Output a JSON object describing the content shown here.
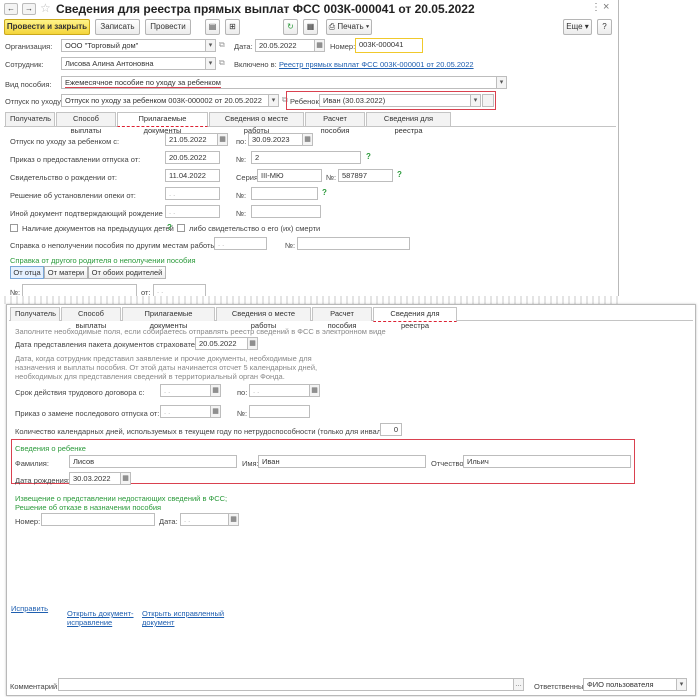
{
  "window1": {
    "title": "Сведения для реестра прямых выплат ФСС 003К-000041 от 20.05.2022",
    "toolbar": {
      "post_close": "Провести и закрыть",
      "save": "Записать",
      "post": "Провести",
      "print": "Печать",
      "more": "Еще",
      "help": "?"
    },
    "fields": {
      "org_label": "Организация:",
      "org_value": "ООО \"Торговый дом\"",
      "date_label": "Дата:",
      "date_value": "20.05.2022",
      "number_label": "Номер:",
      "number_value": "003К-000041",
      "employee_label": "Сотрудник:",
      "employee_value": "Лисова Алина Антоновна",
      "included_label": "Включено в:",
      "included_link": "Реестр прямых выплат ФСС 003К-000001 от 20.05.2022",
      "benefit_label": "Вид пособия:",
      "benefit_value": "Ежемесячное пособие по уходу за ребенком",
      "leave_label": "Отпуск по уходу:",
      "leave_value": "Отпуск по уходу за ребенком 003К-000002 от 20.05.2022",
      "child_label": "Ребенок:",
      "child_value": "Иван  (30.03.2022)"
    },
    "tabs": [
      "Получатель",
      "Способ выплаты",
      "Прилагаемые документы",
      "Сведения о месте работы",
      "Расчет пособия",
      "Сведения для реестра"
    ],
    "active_tab": "Прилагаемые документы",
    "docs": {
      "leave_label": "Отпуск по уходу за ребенком с:",
      "leave_from": "21.05.2022",
      "to_label": "по:",
      "leave_to": "30.09.2023",
      "order_label": "Приказ о предоставлении отпуска от:",
      "order_date": "20.05.2022",
      "no_label": "№:",
      "order_no": "2",
      "birth_cert_label": "Свидетельство о рождении от:",
      "birth_cert_date": "11.04.2022",
      "series_label": "Серия:",
      "series_value": "III-МЮ",
      "birth_cert_no": "587897",
      "guardian_label": "Решение об установлении опеки от:",
      "other_doc_label": "Иной документ подтверждающий рождение от:",
      "prev_docs_label": "Наличие документов на предыдущих детей",
      "death_cert_label": "либо свидетельство о его (их) смерти",
      "no_benefit_label": "Справка о неполучении пособия по другим местам работы от:",
      "parent_cert_title": "Справка от другого родителя о неполучении пособия",
      "parent_options": [
        "От отца",
        "От матери",
        "От обоих родителей"
      ],
      "from_label": "от:",
      "date_placeholder": ". .",
      "question": "?"
    }
  },
  "window2": {
    "tabs": [
      "Получатель",
      "Способ выплаты",
      "Прилагаемые документы",
      "Сведения о месте работы",
      "Расчет пособия",
      "Сведения для реестра"
    ],
    "active_tab": "Сведения для реестра",
    "intro": "Заполните необходимые поля, если собираетесь отправлять реестр сведений в ФСС в электронном виде",
    "submit_label": "Дата представления пакета документов страхователю:",
    "submit_date": "20.05.2022",
    "note_lines": [
      "Дата, когда сотрудник представил заявление и прочие документы, необходимые для",
      "назначения и выплаты пособия. От этой даты начинается отсчет 5 календарных дней,",
      "необходимых для представления сведений в территориальный орган Фонда."
    ],
    "contract_label": "Срок действия трудового договора с:",
    "to_label": "по:",
    "replace_order_label": "Приказ о замене последового отпуска от:",
    "no_label": "№:",
    "days_label": "Количество календарных дней, используемых в текущем году по нетрудоспособности (только для инвалидов):",
    "days_value": "0",
    "child_title": "Сведения о ребенке",
    "surname_label": "Фамилия:",
    "surname_value": "Лисов",
    "name_label": "Имя:",
    "name_value": "Иван",
    "patronymic_label": "Отчество:",
    "patronymic_value": "Ильич",
    "birth_label": "Дата рождения:",
    "birth_value": "30.03.2022",
    "notice_line1": "Извещение о представлении недостающих сведений в ФСС;",
    "notice_line2": "Решение об отказе в назначении пособия",
    "number_label": "Номер:",
    "date_label": "Дата:",
    "links": {
      "fix": "Исправить",
      "open_fix_1": "Открыть документ-",
      "open_fix_2": "исправление",
      "open_fixed_1": "Открыть исправленный",
      "open_fixed_2": "документ"
    },
    "comment_label": "Комментарий:",
    "responsible_label": "Ответственный:",
    "responsible_value": "ФИО пользователя",
    "date_placeholder": ". ."
  }
}
